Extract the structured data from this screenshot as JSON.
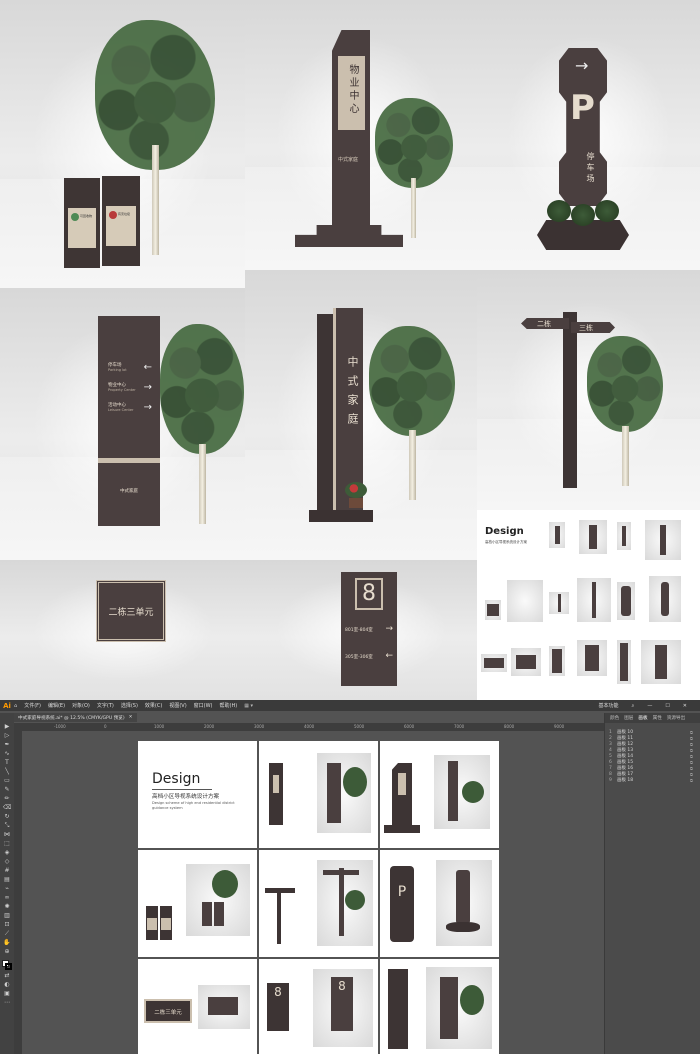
{
  "renders": {
    "property_sign": "物业中心",
    "property_sign_sub": "中式家庭",
    "parking_letter": "P",
    "parking_cn": "停车场",
    "parking_en": "Parking lot",
    "directory_items": [
      {
        "cn": "停车场",
        "en": "Parking lot",
        "arrow": "←"
      },
      {
        "cn": "物业中心",
        "en": "Property Center",
        "arrow": "→"
      },
      {
        "cn": "活动中心",
        "en": "Leisure Center",
        "arrow": "→"
      }
    ],
    "directory_footer": "中式家庭",
    "tall_sign_text": "中式家庭",
    "fingerpost_left": "二栋",
    "fingerpost_right": "三栋",
    "plaque_text": "二栋三单元",
    "door_number": "8",
    "door_rows": [
      {
        "text": "801室-804室",
        "arrow": "→"
      },
      {
        "text": "305室-306室",
        "arrow": "←"
      }
    ],
    "bin_labels": [
      "可回收物",
      "有害垃圾"
    ]
  },
  "overview": {
    "title": "Design",
    "subtitle_cn": "高档小区导视系统设计方案",
    "subtitle_en": "Design scheme of high end residential district guidance system"
  },
  "illustrator": {
    "app_logo": "Ai",
    "menu": [
      "文件(F)",
      "编辑(E)",
      "对象(O)",
      "文字(T)",
      "选择(S)",
      "效果(C)",
      "视图(V)",
      "窗口(W)",
      "帮助(H)"
    ],
    "workspace": "基本功能",
    "doc_tab": "中式家庭导视系统.ai* @ 12.5% (CMYK/GPU 预览)",
    "ruler_ticks": [
      "-1000",
      "0",
      "1000",
      "2000",
      "3000",
      "4000",
      "5000",
      "6000",
      "7000",
      "8000",
      "9000"
    ],
    "panel_tabs": [
      "颜色",
      "图层",
      "画板",
      "属性",
      "资源导出"
    ],
    "panel_active_tab": "画板",
    "artboards": [
      {
        "num": "1",
        "name": "画板 10"
      },
      {
        "num": "2",
        "name": "画板 11"
      },
      {
        "num": "3",
        "name": "画板 12"
      },
      {
        "num": "4",
        "name": "画板 13"
      },
      {
        "num": "5",
        "name": "画板 14"
      },
      {
        "num": "6",
        "name": "画板 15"
      },
      {
        "num": "7",
        "name": "画板 16"
      },
      {
        "num": "8",
        "name": "画板 17"
      },
      {
        "num": "9",
        "name": "画板 18"
      }
    ]
  },
  "colors": {
    "sign_brown": "#4a3f3f",
    "sign_beige": "#cbbfae",
    "ui_dark": "#535353",
    "ui_menubar": "#3a3a3a",
    "ai_orange": "#ff9a00"
  }
}
